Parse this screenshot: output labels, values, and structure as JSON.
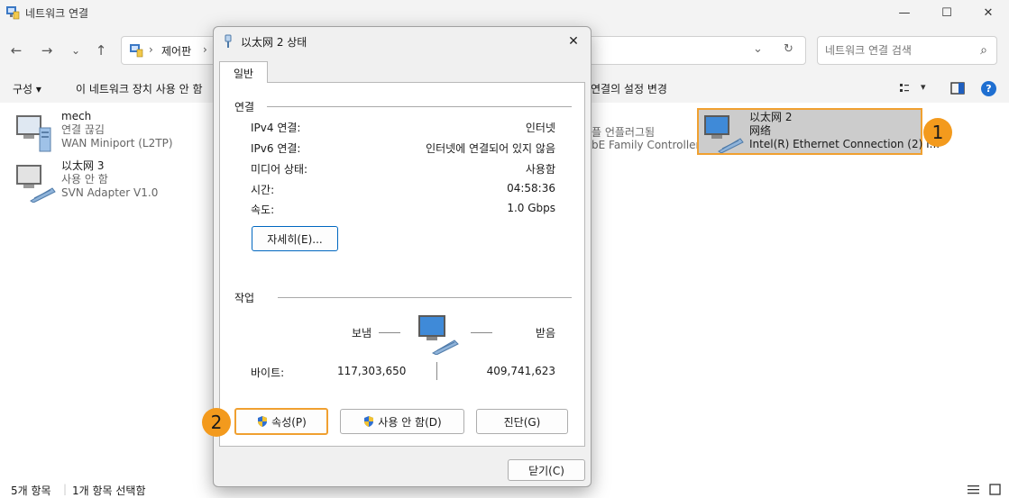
{
  "window": {
    "title": "네트워크 연결",
    "controls": {
      "minimize": "—",
      "maximize": "☐",
      "close": "✕"
    }
  },
  "nav": {
    "back": "←",
    "forward": "→",
    "recent": "⌄",
    "up": "↑",
    "breadcrumb": [
      "제어판"
    ],
    "breadcrumb_sep": "›",
    "dropdown": "⌄",
    "refresh": "↻",
    "search_placeholder": "네트워크 연결 검색",
    "search_icon": "⌕"
  },
  "commandbar": {
    "organize": "구성 ▾",
    "disable": "이 네트워크 장치 사용 안 함",
    "change_settings": "연결의 설정 변경",
    "view": "▾",
    "help": "?"
  },
  "connections": [
    {
      "name": "mech",
      "status": "연결 끊김",
      "device": "WAN Miniport (L2TP)"
    },
    {
      "name": "以太网 3",
      "status": "사용 안 함",
      "device": "SVN Adapter V1.0"
    },
    {
      "name": "以太网 2",
      "status": "网络",
      "device": "Intel(R) Ethernet Connection (2) I..."
    }
  ],
  "partial_connection": {
    "status": "플 언플러그됨",
    "device": "bE Family Controller"
  },
  "statusbar": {
    "count": "5개 항목",
    "selected": "1개 항목 선택함"
  },
  "callouts": [
    "1",
    "2"
  ],
  "dialog": {
    "title": "以太网 2 상태",
    "close": "✕",
    "tab": "일반",
    "connection_group": "연결",
    "rows": [
      {
        "label": "IPv4 연결:",
        "value": "인터넷"
      },
      {
        "label": "IPv6 연결:",
        "value": "인터넷에 연결되어 있지 않음"
      },
      {
        "label": "미디어 상태:",
        "value": "사용함"
      },
      {
        "label": "시간:",
        "value": "04:58:36"
      },
      {
        "label": "속도:",
        "value": "1.0 Gbps"
      }
    ],
    "details_button": "자세히(E)...",
    "activity_group": "작업",
    "sent_label": "보냄",
    "received_label": "받음",
    "bytes_label": "바이트:",
    "bytes_sent": "117,303,650",
    "bytes_received": "409,741,623",
    "properties_button": "속성(P)",
    "disable_button": "사용 안 함(D)",
    "diagnose_button": "진단(G)",
    "close_button": "닫기(C)"
  }
}
